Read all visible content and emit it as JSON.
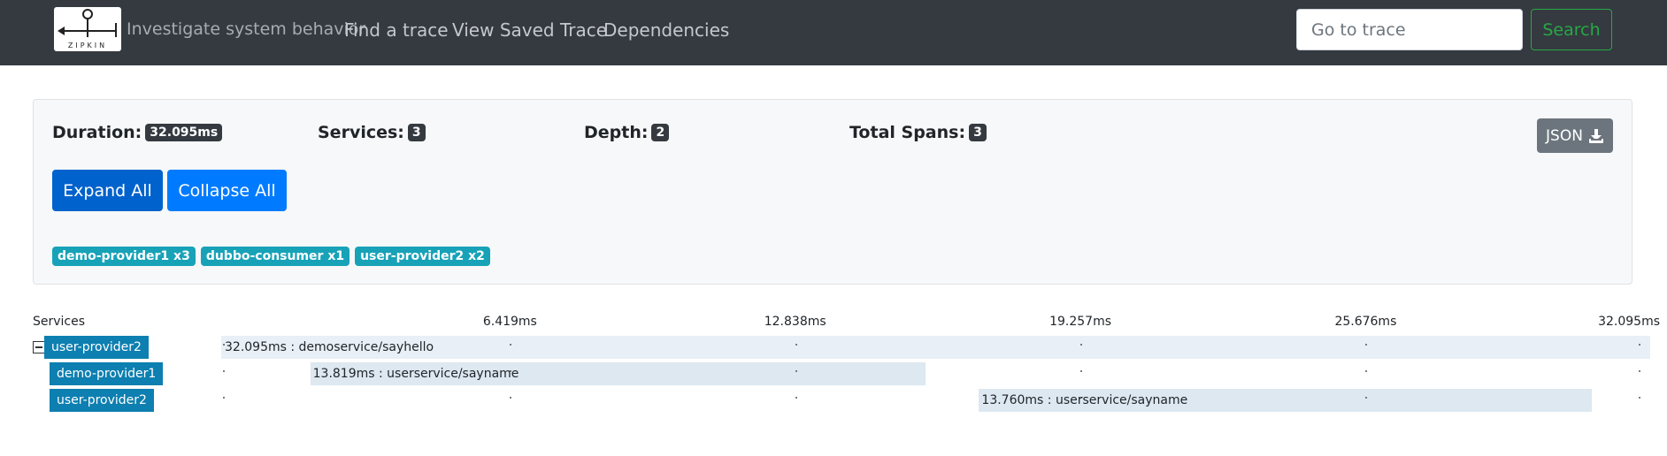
{
  "navbar": {
    "logo_text": "ZIPKIN",
    "tagline": "Investigate system behavior",
    "links": [
      "Find a trace",
      "View Saved Trace",
      "Dependencies"
    ],
    "search_placeholder": "Go to trace",
    "search_button": "Search"
  },
  "summary": {
    "duration_label": "Duration:",
    "duration_value": "32.095ms",
    "services_label": "Services:",
    "services_value": "3",
    "depth_label": "Depth:",
    "depth_value": "2",
    "spans_label": "Total Spans:",
    "spans_value": "3",
    "json_button": "JSON",
    "expand_button": "Expand All",
    "collapse_button": "Collapse All",
    "service_badges": [
      "demo-provider1 x3",
      "dubbo-consumer x1",
      "user-provider2 x2"
    ]
  },
  "timeline": {
    "services_header": "Services",
    "ticks": [
      "6.419ms",
      "12.838ms",
      "19.257ms",
      "25.676ms",
      "32.095ms"
    ],
    "total_ms": 32.095,
    "spans": [
      {
        "service": "user-provider2",
        "label": "32.095ms : demoservice/sayhello",
        "start_ms": 0,
        "duration_ms": 32.095,
        "collapsible": true
      },
      {
        "service": "demo-provider1",
        "label": "13.819ms : userservice/sayname",
        "start_ms": 2.0,
        "duration_ms": 13.819,
        "collapsible": false
      },
      {
        "service": "user-provider2",
        "label": "13.760ms : userservice/sayname",
        "start_ms": 17.02,
        "duration_ms": 13.76,
        "collapsible": false
      }
    ]
  },
  "colors": {
    "navbar_bg": "#343a40",
    "service_label_bg": "#0d7fb0",
    "badge_teal": "#17a2b8",
    "primary_blue": "#007bff",
    "search_green": "#28a745"
  }
}
